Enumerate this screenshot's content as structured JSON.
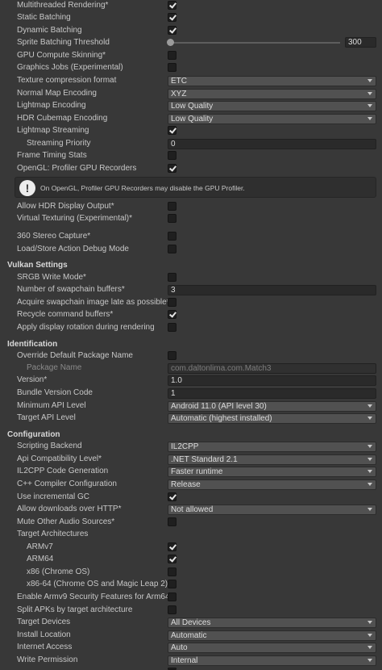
{
  "rendering_rows": [
    {
      "label": "Multithreaded Rendering*",
      "checked": true
    },
    {
      "label": "Static Batching",
      "checked": true
    },
    {
      "label": "Dynamic Batching",
      "checked": true
    }
  ],
  "sprite_batching": {
    "label": "Sprite Batching Threshold",
    "value": "300",
    "fraction": 0.0
  },
  "gpu_rows": [
    {
      "label": "GPU Compute Skinning*",
      "checked": false
    },
    {
      "label": "Graphics Jobs (Experimental)",
      "checked": false
    }
  ],
  "texture_rows": [
    {
      "label": "Texture compression format",
      "value": "ETC"
    },
    {
      "label": "Normal Map Encoding",
      "value": "XYZ"
    },
    {
      "label": "Lightmap Encoding",
      "value": "Low Quality"
    },
    {
      "label": "HDR Cubemap Encoding",
      "value": "Low Quality"
    }
  ],
  "lightmap_streaming": {
    "label": "Lightmap Streaming",
    "checked": true
  },
  "streaming_priority": {
    "label": "Streaming Priority",
    "value": "0"
  },
  "timing_rows": [
    {
      "label": "Frame Timing Stats",
      "checked": false
    },
    {
      "label": "OpenGL: Profiler GPU Recorders",
      "checked": true
    }
  ],
  "help": {
    "icon": "!",
    "text": "On OpenGL, Profiler GPU Recorders may disable the GPU Profiler."
  },
  "display_rows": [
    {
      "label": "Allow HDR Display Output*",
      "checked": false
    },
    {
      "label": "Virtual Texturing (Experimental)*",
      "checked": false
    }
  ],
  "stereo_rows": [
    {
      "label": "360 Stereo Capture*",
      "checked": false
    },
    {
      "label": "Load/Store Action Debug Mode",
      "checked": false
    }
  ],
  "vulkan": {
    "header": "Vulkan Settings",
    "srgb": {
      "label": "SRGB Write Mode*",
      "checked": false
    },
    "swapchain": {
      "label": "Number of swapchain buffers*",
      "value": "3"
    },
    "acquire": {
      "label": "Acquire swapchain image late as possible*",
      "checked": false
    },
    "recycle": {
      "label": "Recycle command buffers*",
      "checked": true
    },
    "rotation": {
      "label": "Apply display rotation during rendering",
      "checked": false
    }
  },
  "identification": {
    "header": "Identification",
    "override": {
      "label": "Override Default Package Name",
      "checked": false
    },
    "package": {
      "label": "Package Name",
      "value": "com.daltonlima.com.Match3"
    },
    "version": {
      "label": "Version*",
      "value": "1.0"
    },
    "bundle": {
      "label": "Bundle Version Code",
      "value": "1"
    },
    "min_api": {
      "label": "Minimum API Level",
      "value": "Android 11.0 (API level 30)"
    },
    "target_api": {
      "label": "Target API Level",
      "value": "Automatic (highest installed)"
    }
  },
  "configuration": {
    "header": "Configuration",
    "dropdowns": [
      {
        "label": "Scripting Backend",
        "value": "IL2CPP"
      },
      {
        "label": "Api Compatibility Level*",
        "value": ".NET Standard 2.1"
      },
      {
        "label": "IL2CPP Code Generation",
        "value": "Faster runtime"
      },
      {
        "label": "C++ Compiler Configuration",
        "value": "Release"
      }
    ],
    "incremental_gc": {
      "label": "Use incremental GC",
      "checked": true
    },
    "downloads": {
      "label": "Allow downloads over HTTP*",
      "value": "Not allowed"
    },
    "mute_audio": {
      "label": "Mute Other Audio Sources*",
      "checked": false
    },
    "target_arch_label": "Target Architectures",
    "architectures": [
      {
        "label": "ARMv7",
        "checked": true
      },
      {
        "label": "ARM64",
        "checked": true
      },
      {
        "label": "x86 (Chrome OS)",
        "checked": false
      },
      {
        "label": "x86-64 (Chrome OS and Magic Leap 2)",
        "checked": false
      }
    ],
    "armv9": {
      "label": "Enable Armv9 Security Features for Arm64",
      "checked": false
    },
    "split_apks": {
      "label": "Split APKs by target architecture",
      "checked": false
    },
    "bottom_dropdowns": [
      {
        "label": "Target Devices",
        "value": "All Devices"
      },
      {
        "label": "Install Location",
        "value": "Automatic"
      },
      {
        "label": "Internet Access",
        "value": "Auto"
      },
      {
        "label": "Write Permission",
        "value": "Internal"
      }
    ]
  }
}
